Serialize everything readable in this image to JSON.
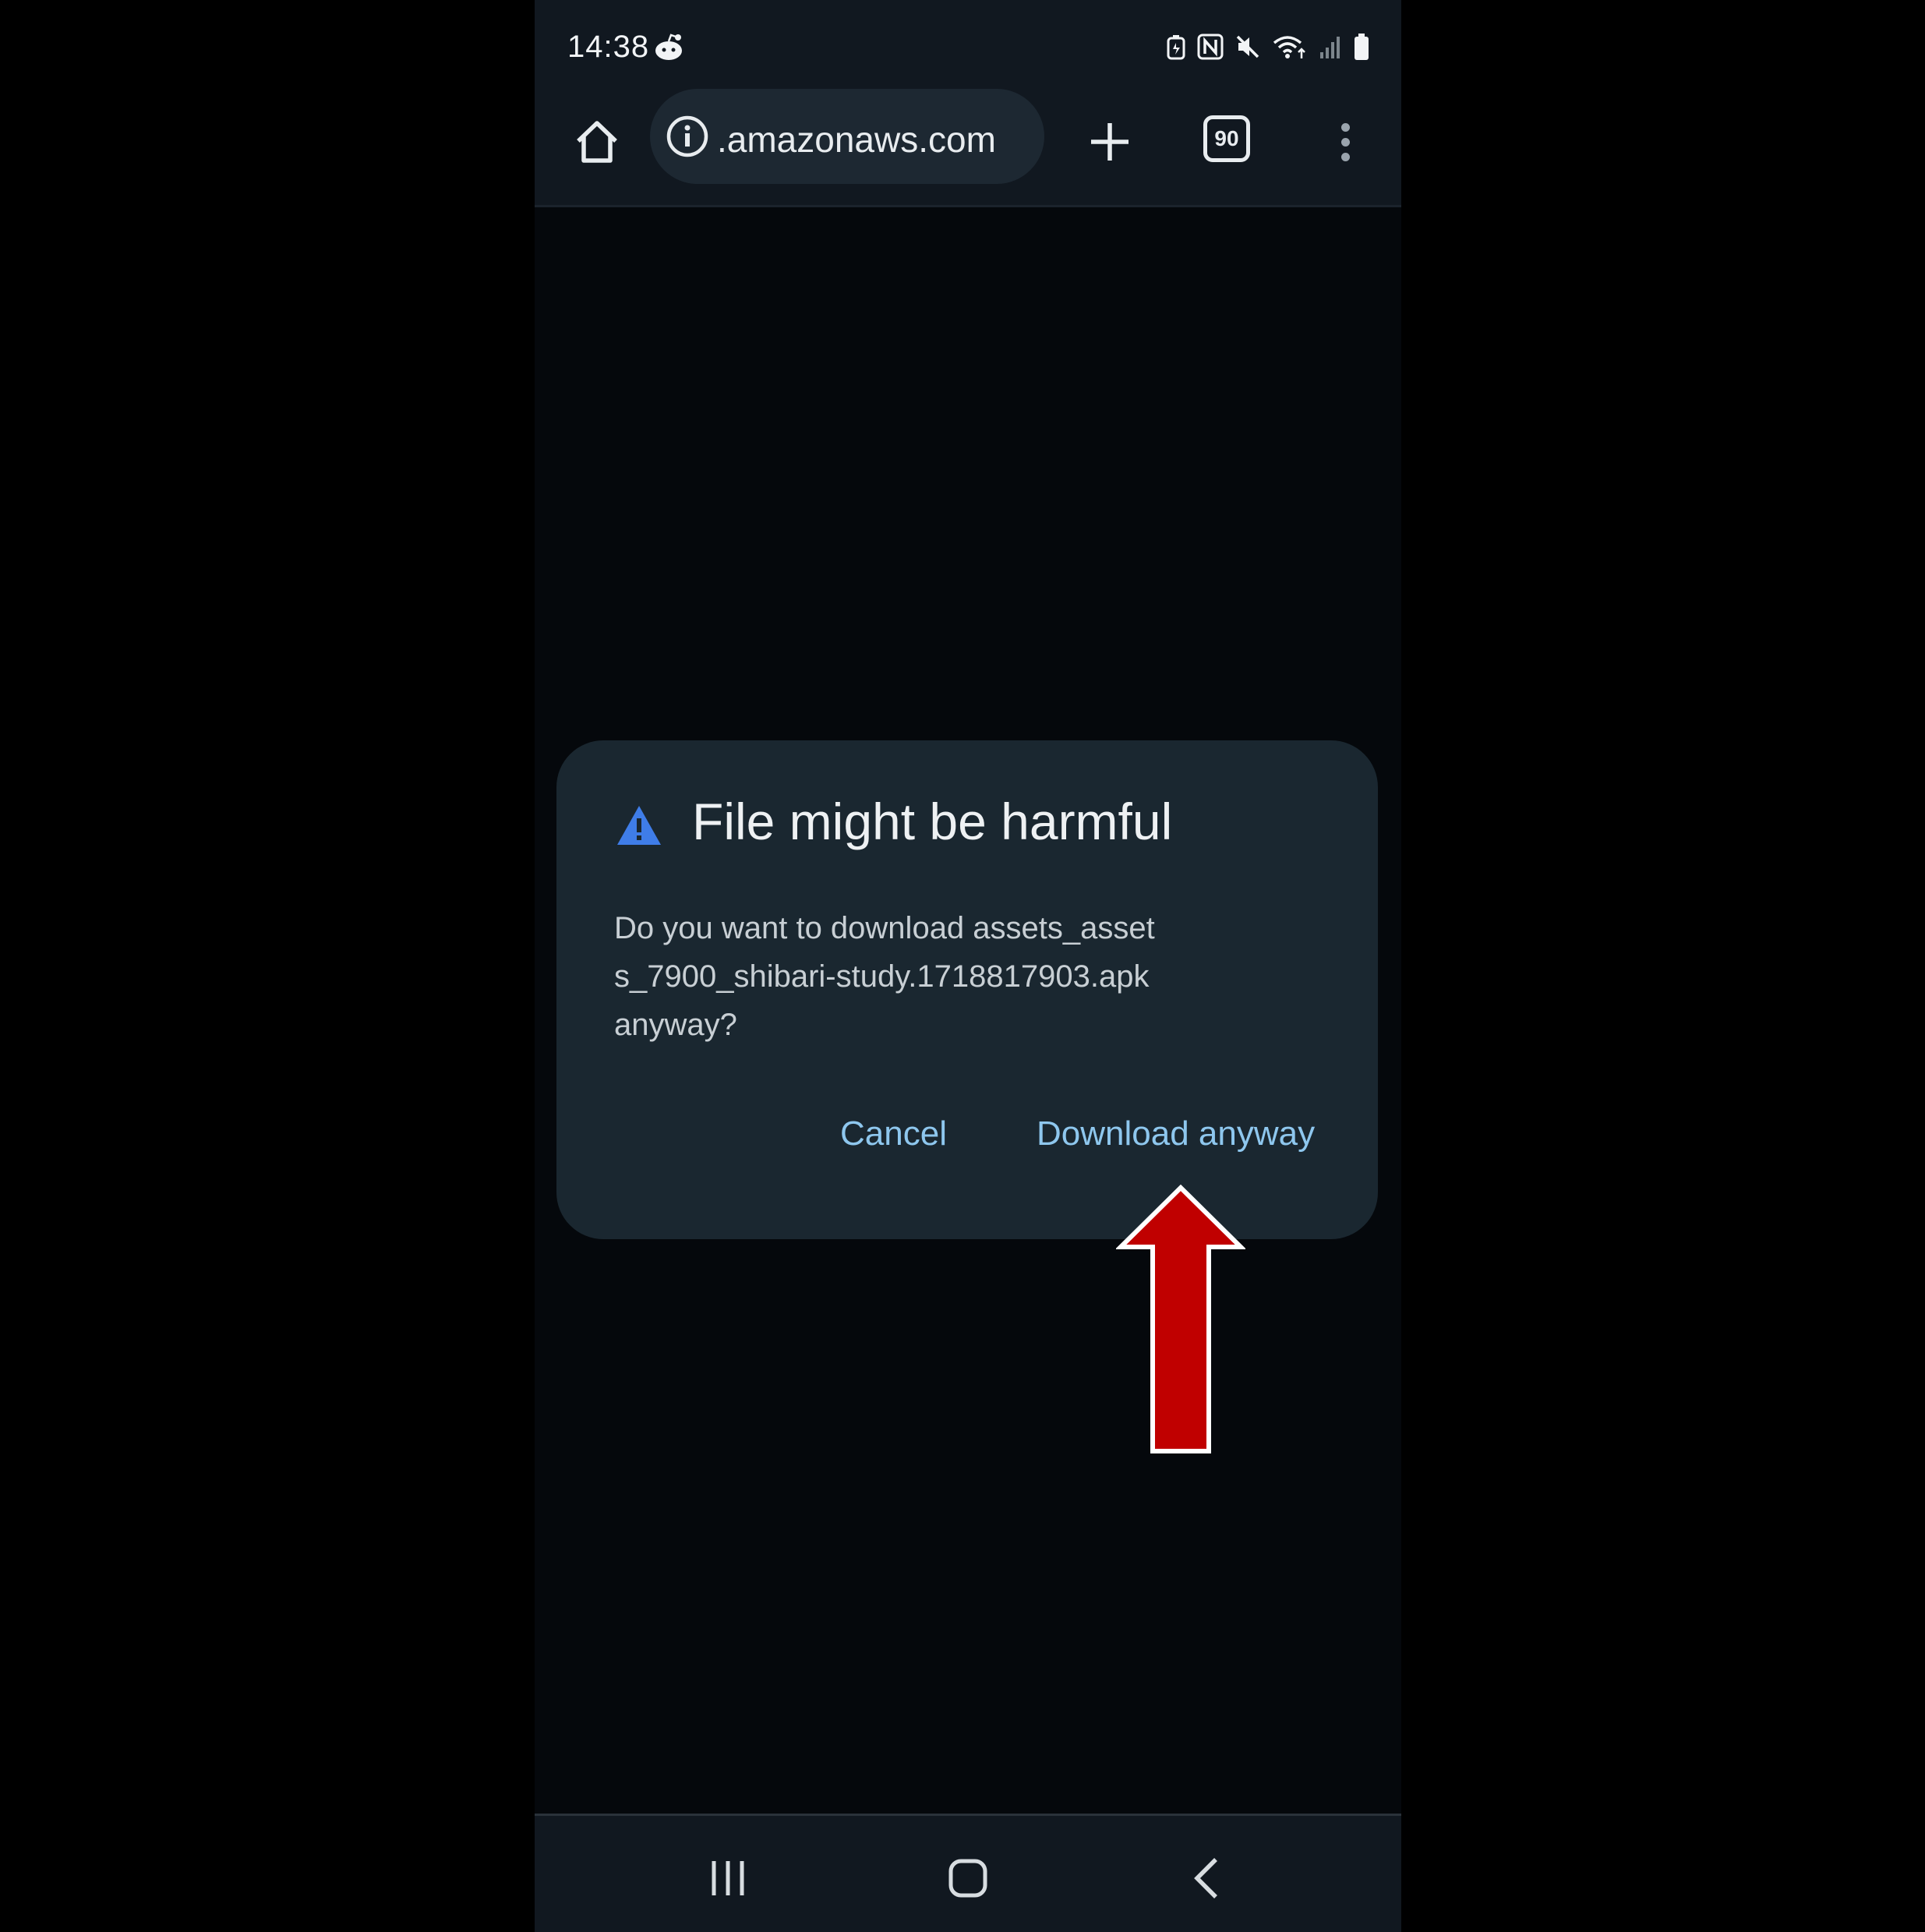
{
  "status_bar": {
    "time": "14:38",
    "icons": [
      "reddit-icon",
      "battery-saver-icon",
      "nfc-icon",
      "mute-icon",
      "wifi-icon",
      "signal-icon",
      "battery-icon"
    ]
  },
  "browser": {
    "url": ".amazonaws.com",
    "tab_count": "90"
  },
  "dialog": {
    "title": "File might be harmful",
    "body_lines": [
      "Do you want to download assets_asset",
      "s_7900_shibari-study.1718817903.apk",
      "anyway?"
    ],
    "cancel_label": "Cancel",
    "download_label": "Download anyway"
  },
  "colors": {
    "accent_text": "#8ec7ee",
    "warning_icon": "#3f7de8",
    "annotation_arrow": "#c00000",
    "dialog_bg": "#1a2730"
  }
}
